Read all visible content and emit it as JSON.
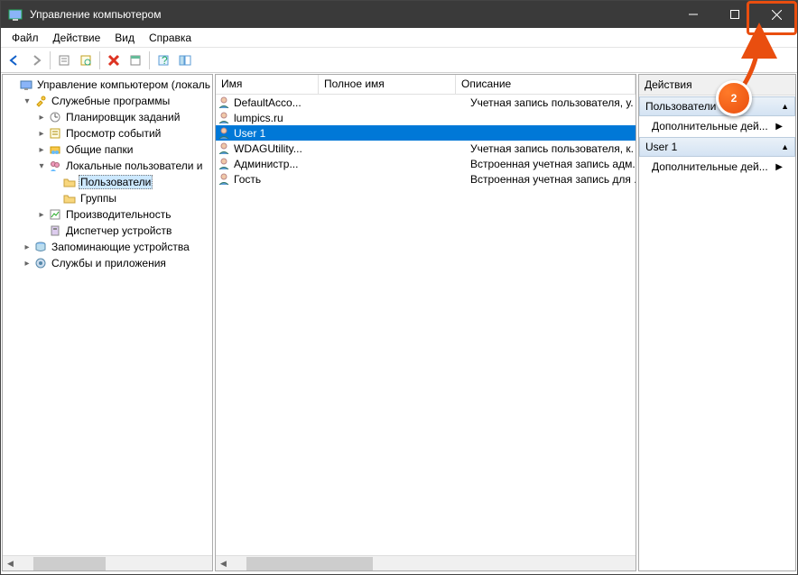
{
  "window_title": "Управление компьютером",
  "menu": [
    "Файл",
    "Действие",
    "Вид",
    "Справка"
  ],
  "tree": [
    {
      "indent": 0,
      "toggle": "",
      "icon": "pc",
      "label": "Управление компьютером (локаль"
    },
    {
      "indent": 1,
      "toggle": "v",
      "icon": "tools",
      "label": "Служебные программы"
    },
    {
      "indent": 2,
      "toggle": ">",
      "icon": "clock",
      "label": "Планировщик заданий"
    },
    {
      "indent": 2,
      "toggle": ">",
      "icon": "event",
      "label": "Просмотр событий"
    },
    {
      "indent": 2,
      "toggle": ">",
      "icon": "shared",
      "label": "Общие папки"
    },
    {
      "indent": 2,
      "toggle": "v",
      "icon": "users",
      "label": "Локальные пользователи и"
    },
    {
      "indent": 3,
      "toggle": "",
      "icon": "folder",
      "label": "Пользователи",
      "selected": true
    },
    {
      "indent": 3,
      "toggle": "",
      "icon": "folder",
      "label": "Группы"
    },
    {
      "indent": 2,
      "toggle": ">",
      "icon": "perf",
      "label": "Производительность"
    },
    {
      "indent": 2,
      "toggle": "",
      "icon": "device",
      "label": "Диспетчер устройств"
    },
    {
      "indent": 1,
      "toggle": ">",
      "icon": "storage",
      "label": "Запоминающие устройства"
    },
    {
      "indent": 1,
      "toggle": ">",
      "icon": "services",
      "label": "Службы и приложения"
    }
  ],
  "columns": {
    "name": "Имя",
    "full": "Полное имя",
    "desc": "Описание"
  },
  "rows": [
    {
      "name": "DefaultAcco...",
      "full": "",
      "desc": "Учетная запись пользователя, у."
    },
    {
      "name": "lumpics.ru",
      "full": "",
      "desc": ""
    },
    {
      "name": "User 1",
      "full": "",
      "desc": "",
      "selected": true
    },
    {
      "name": "WDAGUtility...",
      "full": "",
      "desc": "Учетная запись пользователя, к."
    },
    {
      "name": "Администр...",
      "full": "",
      "desc": "Встроенная учетная запись адм."
    },
    {
      "name": "Гость",
      "full": "",
      "desc": "Встроенная учетная запись для ."
    }
  ],
  "actions": {
    "header": "Действия",
    "groups": [
      {
        "title": "Пользователи",
        "items": [
          "Дополнительные дей..."
        ]
      },
      {
        "title": "User 1",
        "items": [
          "Дополнительные дей..."
        ]
      }
    ]
  },
  "annotation": {
    "badge": "2"
  }
}
